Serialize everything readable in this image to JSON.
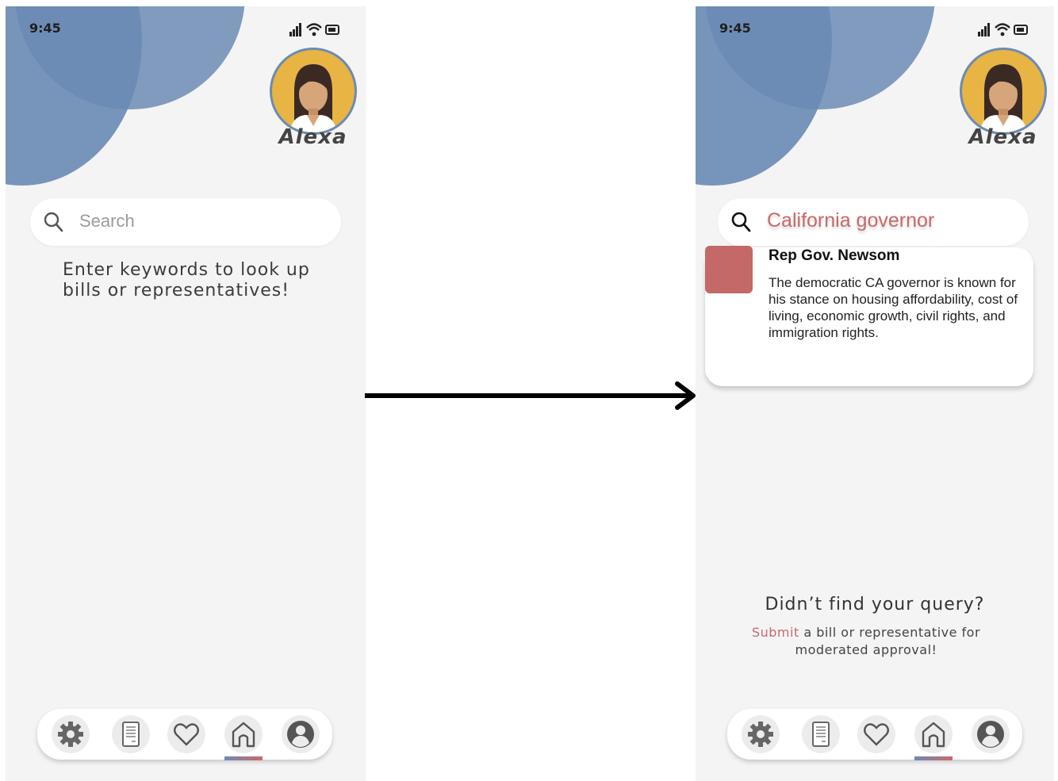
{
  "left_screen": {
    "status_time": "9:45",
    "user_name": "Alexa",
    "search": {
      "placeholder": "Search"
    },
    "hint_line1": "Enter keywords to look up",
    "hint_line2": "bills or representatives!"
  },
  "right_screen": {
    "status_time": "9:45",
    "user_name": "Alexa",
    "search": {
      "value": "California governor"
    },
    "result": {
      "title": "Rep Gov. Newsom",
      "description": "The democratic CA governor is known for his stance on housing affordability, cost of living, economic growth, civil rights, and immigration rights."
    },
    "didnt_find": "Didn’t find your query?",
    "submit_link": "Submit",
    "submit_rest": "a bill or representative for moderated approval!"
  },
  "nav": {
    "items": [
      "settings-icon",
      "document-icon",
      "heart-icon",
      "home-icon",
      "profile-icon"
    ],
    "active": "home-icon"
  },
  "colors": {
    "accent_blue": "#6b8bb4",
    "accent_red": "#c96a6a",
    "avatar_bg": "#e8b443"
  }
}
